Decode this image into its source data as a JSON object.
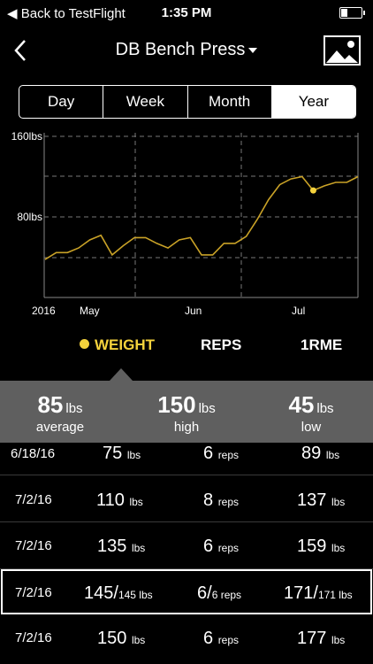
{
  "status_bar": {
    "back_label": "Back to TestFlight",
    "time": "1:35 PM"
  },
  "nav": {
    "title": "DB Bench Press"
  },
  "segments": {
    "items": [
      "Day",
      "Week",
      "Month",
      "Year"
    ],
    "active": "Year"
  },
  "chart_data": {
    "type": "line",
    "y_ticks": [
      "160lbs",
      "80lbs"
    ],
    "ylim": [
      25,
      165
    ],
    "x_labels": [
      "2016",
      "May",
      "Jun",
      "Jul"
    ],
    "grid": true,
    "color": "#c9a227",
    "highlight_color": "#f4d23c",
    "values": [
      58,
      64,
      64,
      68,
      75,
      79,
      62,
      70,
      77,
      77,
      72,
      68,
      75,
      77,
      62,
      62,
      72,
      72,
      78,
      93,
      110,
      123,
      128,
      130,
      118,
      122,
      125,
      125,
      130
    ],
    "highlight_index": 24
  },
  "metrics": {
    "items": [
      "WEIGHT",
      "REPS",
      "1RME"
    ],
    "active": "WEIGHT"
  },
  "summary": {
    "average": {
      "value": "85",
      "unit": "lbs",
      "label": "average"
    },
    "high": {
      "value": "150",
      "unit": "lbs",
      "label": "high"
    },
    "low": {
      "value": "45",
      "unit": "lbs",
      "label": "low"
    }
  },
  "rows": [
    {
      "date": "6/18/16",
      "weight": "75",
      "weight_unit": "lbs",
      "reps": "6",
      "reps_unit": "reps",
      "orm": "89",
      "orm_unit": "lbs"
    },
    {
      "date": "7/2/16",
      "weight": "110",
      "weight_unit": "lbs",
      "reps": "8",
      "reps_unit": "reps",
      "orm": "137",
      "orm_unit": "lbs"
    },
    {
      "date": "7/2/16",
      "weight": "135",
      "weight_unit": "lbs",
      "reps": "6",
      "reps_unit": "reps",
      "orm": "159",
      "orm_unit": "lbs"
    },
    {
      "date": "7/2/16",
      "weight": "145/",
      "weight_unit": "145 lbs",
      "reps": "6/",
      "reps_unit": "6 reps",
      "orm": "171/",
      "orm_unit": "171 lbs"
    },
    {
      "date": "7/2/16",
      "weight": "150",
      "weight_unit": "lbs",
      "reps": "6",
      "reps_unit": "reps",
      "orm": "177",
      "orm_unit": "lbs"
    }
  ]
}
